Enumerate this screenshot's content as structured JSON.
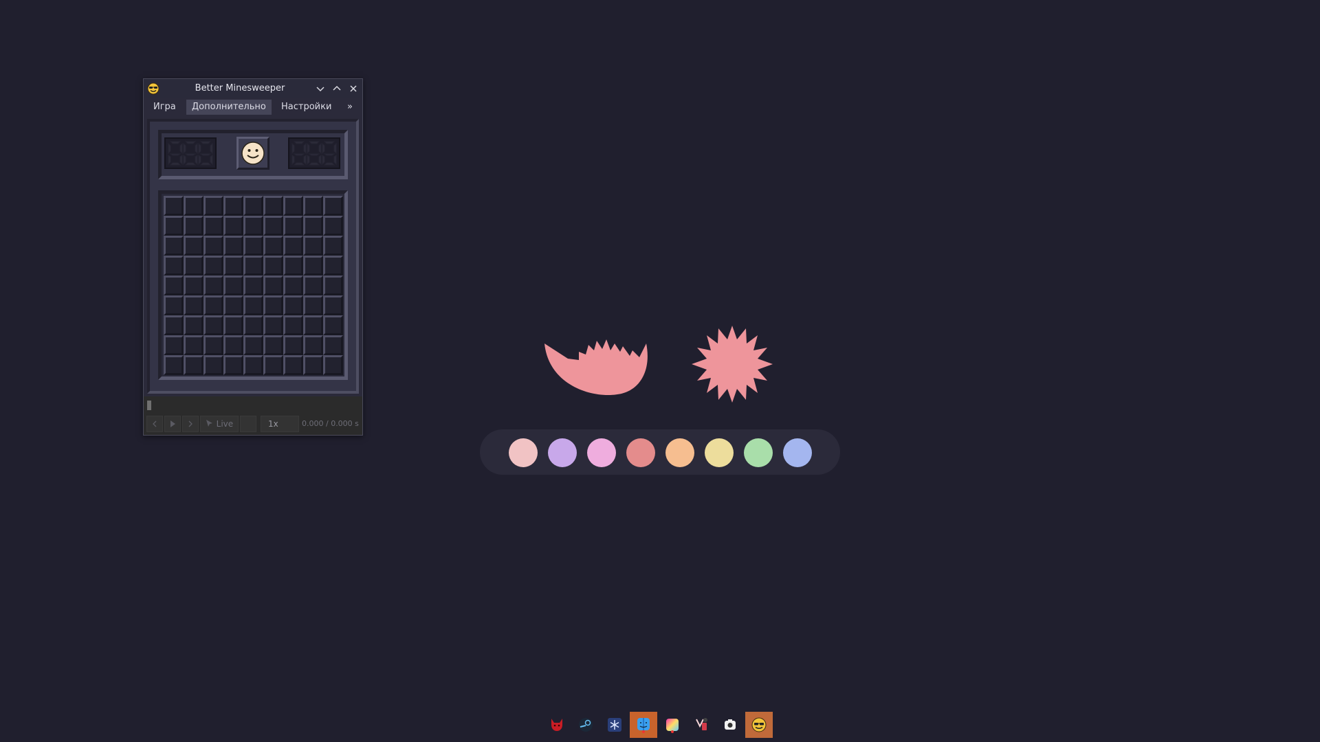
{
  "window": {
    "title": "Better Minesweeper",
    "app_icon": "sunglasses-smiley-icon",
    "controls": [
      "chevron-down-icon",
      "chevron-up-icon",
      "close-icon"
    ]
  },
  "menubar": {
    "game": "Игра",
    "extra": "Дополнительно",
    "settings": "Настройки",
    "more": "»"
  },
  "game": {
    "mines_counter_icon": "seven-segment-display",
    "timer_icon": "seven-segment-display",
    "face_icon": "smiley-face-icon",
    "rows": 9,
    "cols": 9
  },
  "replay": {
    "live_label": "Live",
    "speed": "1x",
    "time": "0.000 / 0.000 s"
  },
  "palette": {
    "colors": [
      "#f1c3c4",
      "#c8a8ea",
      "#efadde",
      "#e48c8c",
      "#f6be90",
      "#eddd9c",
      "#a9deaa",
      "#a4b6ef"
    ]
  },
  "art": {
    "shape_color": "#ee959b",
    "shapes": [
      "crown-splash-shape",
      "starburst-shape"
    ]
  },
  "taskbar": {
    "apps": [
      "devil-icon",
      "steam-icon",
      "snowflake-icon",
      "finder-icon",
      "gradient-app-icon",
      "notes-icon",
      "camera-icon",
      "minesweeper-icon"
    ]
  }
}
